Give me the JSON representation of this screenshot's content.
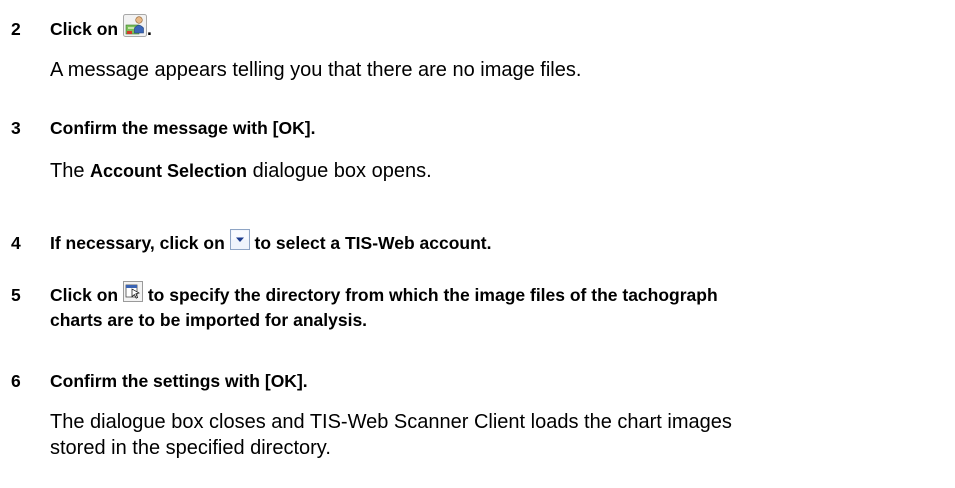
{
  "steps": [
    {
      "number": "2",
      "text_before": "Click on",
      "icon": "scanner-client-icon",
      "text_after": ".",
      "result": "A message appears telling you that there are no image files."
    },
    {
      "number": "3",
      "text": "Confirm the message with [OK].",
      "result_before": "The",
      "result_bold": "Account Selection",
      "result_after": "dialogue box opens."
    },
    {
      "number": "4",
      "text_before": "If necessary, click on",
      "icon": "dropdown-arrow-icon",
      "text_after": "to select a TIS-Web account."
    },
    {
      "number": "5",
      "text_before": "Click on",
      "icon": "folder-browse-icon",
      "text_after": "to specify the directory from which the image files of the tachograph",
      "text_line2": "charts are to be imported for analysis."
    },
    {
      "number": "6",
      "text": "Confirm the settings with [OK].",
      "result_line1": "The dialogue box closes and TIS-Web Scanner Client loads the chart images",
      "result_line2": "stored in the specified directory."
    }
  ]
}
